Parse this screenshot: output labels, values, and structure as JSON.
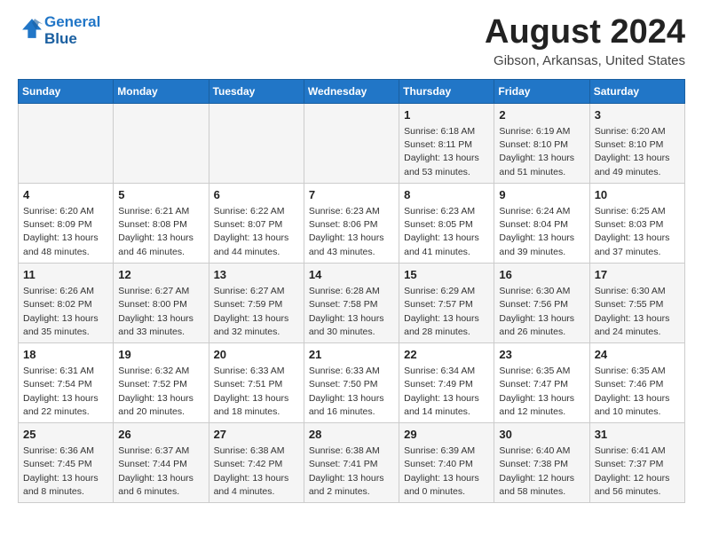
{
  "header": {
    "logo_line1": "General",
    "logo_line2": "Blue",
    "month": "August 2024",
    "location": "Gibson, Arkansas, United States"
  },
  "weekdays": [
    "Sunday",
    "Monday",
    "Tuesday",
    "Wednesday",
    "Thursday",
    "Friday",
    "Saturday"
  ],
  "weeks": [
    [
      {
        "day": "",
        "info": ""
      },
      {
        "day": "",
        "info": ""
      },
      {
        "day": "",
        "info": ""
      },
      {
        "day": "",
        "info": ""
      },
      {
        "day": "1",
        "info": "Sunrise: 6:18 AM\nSunset: 8:11 PM\nDaylight: 13 hours\nand 53 minutes."
      },
      {
        "day": "2",
        "info": "Sunrise: 6:19 AM\nSunset: 8:10 PM\nDaylight: 13 hours\nand 51 minutes."
      },
      {
        "day": "3",
        "info": "Sunrise: 6:20 AM\nSunset: 8:10 PM\nDaylight: 13 hours\nand 49 minutes."
      }
    ],
    [
      {
        "day": "4",
        "info": "Sunrise: 6:20 AM\nSunset: 8:09 PM\nDaylight: 13 hours\nand 48 minutes."
      },
      {
        "day": "5",
        "info": "Sunrise: 6:21 AM\nSunset: 8:08 PM\nDaylight: 13 hours\nand 46 minutes."
      },
      {
        "day": "6",
        "info": "Sunrise: 6:22 AM\nSunset: 8:07 PM\nDaylight: 13 hours\nand 44 minutes."
      },
      {
        "day": "7",
        "info": "Sunrise: 6:23 AM\nSunset: 8:06 PM\nDaylight: 13 hours\nand 43 minutes."
      },
      {
        "day": "8",
        "info": "Sunrise: 6:23 AM\nSunset: 8:05 PM\nDaylight: 13 hours\nand 41 minutes."
      },
      {
        "day": "9",
        "info": "Sunrise: 6:24 AM\nSunset: 8:04 PM\nDaylight: 13 hours\nand 39 minutes."
      },
      {
        "day": "10",
        "info": "Sunrise: 6:25 AM\nSunset: 8:03 PM\nDaylight: 13 hours\nand 37 minutes."
      }
    ],
    [
      {
        "day": "11",
        "info": "Sunrise: 6:26 AM\nSunset: 8:02 PM\nDaylight: 13 hours\nand 35 minutes."
      },
      {
        "day": "12",
        "info": "Sunrise: 6:27 AM\nSunset: 8:00 PM\nDaylight: 13 hours\nand 33 minutes."
      },
      {
        "day": "13",
        "info": "Sunrise: 6:27 AM\nSunset: 7:59 PM\nDaylight: 13 hours\nand 32 minutes."
      },
      {
        "day": "14",
        "info": "Sunrise: 6:28 AM\nSunset: 7:58 PM\nDaylight: 13 hours\nand 30 minutes."
      },
      {
        "day": "15",
        "info": "Sunrise: 6:29 AM\nSunset: 7:57 PM\nDaylight: 13 hours\nand 28 minutes."
      },
      {
        "day": "16",
        "info": "Sunrise: 6:30 AM\nSunset: 7:56 PM\nDaylight: 13 hours\nand 26 minutes."
      },
      {
        "day": "17",
        "info": "Sunrise: 6:30 AM\nSunset: 7:55 PM\nDaylight: 13 hours\nand 24 minutes."
      }
    ],
    [
      {
        "day": "18",
        "info": "Sunrise: 6:31 AM\nSunset: 7:54 PM\nDaylight: 13 hours\nand 22 minutes."
      },
      {
        "day": "19",
        "info": "Sunrise: 6:32 AM\nSunset: 7:52 PM\nDaylight: 13 hours\nand 20 minutes."
      },
      {
        "day": "20",
        "info": "Sunrise: 6:33 AM\nSunset: 7:51 PM\nDaylight: 13 hours\nand 18 minutes."
      },
      {
        "day": "21",
        "info": "Sunrise: 6:33 AM\nSunset: 7:50 PM\nDaylight: 13 hours\nand 16 minutes."
      },
      {
        "day": "22",
        "info": "Sunrise: 6:34 AM\nSunset: 7:49 PM\nDaylight: 13 hours\nand 14 minutes."
      },
      {
        "day": "23",
        "info": "Sunrise: 6:35 AM\nSunset: 7:47 PM\nDaylight: 13 hours\nand 12 minutes."
      },
      {
        "day": "24",
        "info": "Sunrise: 6:35 AM\nSunset: 7:46 PM\nDaylight: 13 hours\nand 10 minutes."
      }
    ],
    [
      {
        "day": "25",
        "info": "Sunrise: 6:36 AM\nSunset: 7:45 PM\nDaylight: 13 hours\nand 8 minutes."
      },
      {
        "day": "26",
        "info": "Sunrise: 6:37 AM\nSunset: 7:44 PM\nDaylight: 13 hours\nand 6 minutes."
      },
      {
        "day": "27",
        "info": "Sunrise: 6:38 AM\nSunset: 7:42 PM\nDaylight: 13 hours\nand 4 minutes."
      },
      {
        "day": "28",
        "info": "Sunrise: 6:38 AM\nSunset: 7:41 PM\nDaylight: 13 hours\nand 2 minutes."
      },
      {
        "day": "29",
        "info": "Sunrise: 6:39 AM\nSunset: 7:40 PM\nDaylight: 13 hours\nand 0 minutes."
      },
      {
        "day": "30",
        "info": "Sunrise: 6:40 AM\nSunset: 7:38 PM\nDaylight: 12 hours\nand 58 minutes."
      },
      {
        "day": "31",
        "info": "Sunrise: 6:41 AM\nSunset: 7:37 PM\nDaylight: 12 hours\nand 56 minutes."
      }
    ]
  ]
}
